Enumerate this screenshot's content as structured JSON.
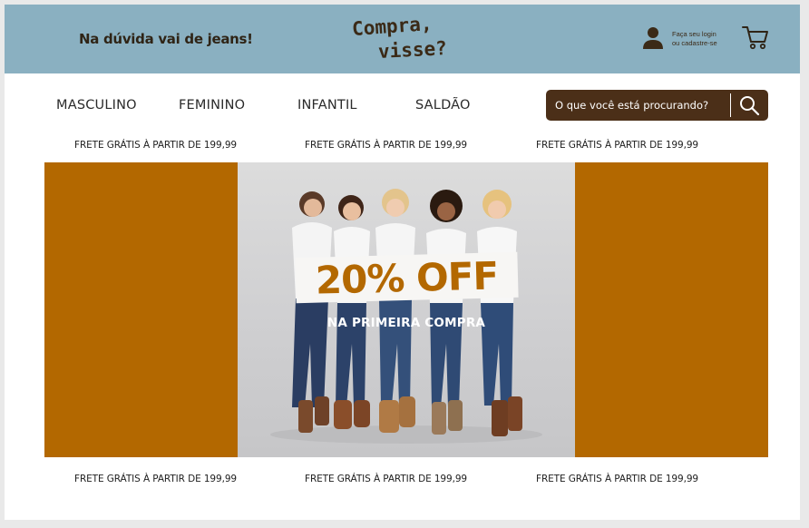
{
  "header": {
    "tagline": "Na dúvida vai de jeans!",
    "logo_line1": "Compra,",
    "logo_line2": "visse?",
    "login_line1": "Faça seu login",
    "login_line2": "ou cadastre-se",
    "user_icon": "user-icon",
    "cart_icon": "cart-icon"
  },
  "nav": {
    "items": [
      "MASCULINO",
      "FEMININO",
      "INFANTIL",
      "SALDÃO"
    ]
  },
  "search": {
    "placeholder": "O que você está procurando?",
    "icon": "search-icon"
  },
  "promos_top": [
    "FRETE GRÁTIS À PARTIR DE 199,99",
    "FRETE GRÁTIS À PARTIR DE 199,99",
    "FRETE GRÁTIS À PARTIR DE 199,99"
  ],
  "banner": {
    "headline": "20% OFF",
    "subline": "NA PRIMEIRA COMPRA"
  },
  "promos_bottom": [
    "FRETE GRÁTIS À PARTIR DE 199,99",
    "FRETE GRÁTIS À PARTIR DE 199,99",
    "FRETE GRÁTIS À PARTIR DE 199,99"
  ],
  "colors": {
    "topbar": "#8ab0c1",
    "brand_brown": "#4b2f18",
    "accent_orange": "#b36800"
  }
}
